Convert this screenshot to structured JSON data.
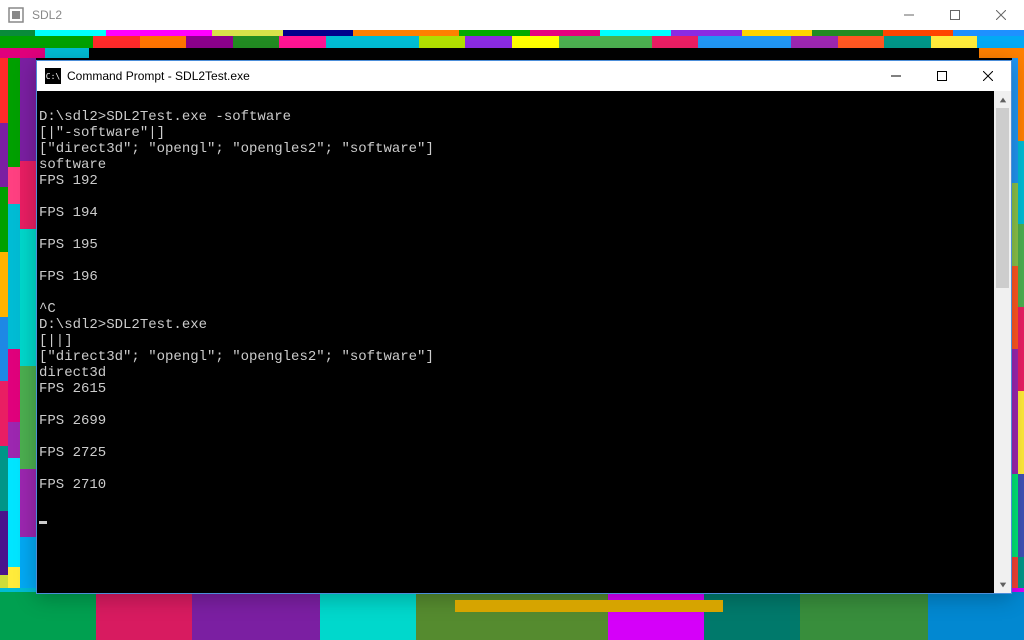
{
  "outer": {
    "title": "SDL2"
  },
  "cmd": {
    "title": "Command Prompt - SDL2Test.exe",
    "icon_label": "C:\\",
    "lines": [
      "",
      "D:\\sdl2>SDL2Test.exe -software",
      "[|\"-software\"|]",
      "[\"direct3d\"; \"opengl\"; \"opengles2\"; \"software\"]",
      "software",
      "FPS 192",
      "",
      "FPS 194",
      "",
      "FPS 195",
      "",
      "FPS 196",
      "",
      "^C",
      "D:\\sdl2>SDL2Test.exe",
      "[||]",
      "[\"direct3d\"; \"opengl\"; \"opengles2\"; \"software\"]",
      "direct3d",
      "FPS 2615",
      "",
      "FPS 2699",
      "",
      "FPS 2725",
      "",
      "FPS 2710",
      ""
    ]
  }
}
